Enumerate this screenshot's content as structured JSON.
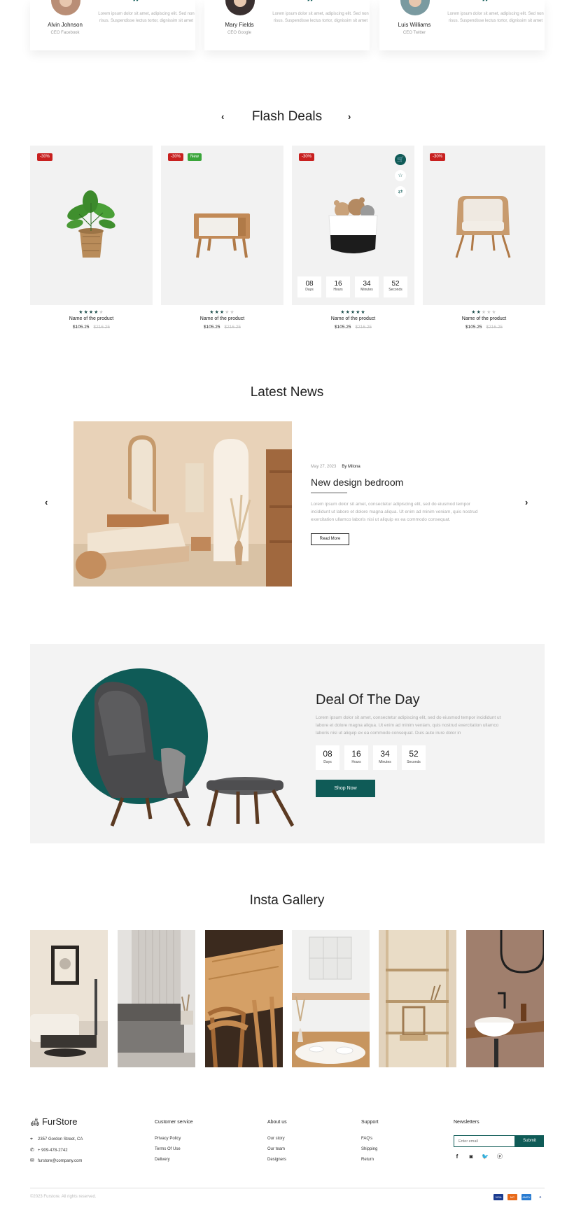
{
  "testimonials": [
    {
      "name": "Alvin Johnson",
      "role": "CEO Facebook",
      "text": "Lorem ipsum dolor sit amet, adipiscing elit. Sed non risus. Suspendisse lectus tortor, dignissim sit amet"
    },
    {
      "name": "Mary Fields",
      "role": "CEO Google",
      "text": "Lorem ipsum dolor sit amet, adipiscing elit. Sed non risus. Suspendisse lectus tortor, dignissim sit amet"
    },
    {
      "name": "Luis Williams",
      "role": "CEO Twitter",
      "text": "Lorem ipsum dolor sit amet, adipiscing elit. Sed non risus. Suspendisse lectus tortor, dignissim sit amet"
    }
  ],
  "flash": {
    "title": "Flash Deals",
    "prev_icon": "chevron-left-icon",
    "next_icon": "chevron-right-icon",
    "products": [
      {
        "badges": [
          "-30%"
        ],
        "name": "Name of the product",
        "price": "$105.25",
        "old_price": "$216.25",
        "rating": 4,
        "image": "potted-plant"
      },
      {
        "badges": [
          "-30%",
          "New"
        ],
        "name": "Name of the product",
        "price": "$105.25",
        "old_price": "$216.25",
        "rating": 3,
        "image": "nightstand"
      },
      {
        "badges": [
          "-30%"
        ],
        "name": "Name of the product",
        "price": "$105.25",
        "old_price": "$216.25",
        "rating": 5,
        "image": "toy-basket"
      },
      {
        "badges": [
          "-30%"
        ],
        "name": "Name of the product",
        "price": "$105.25",
        "old_price": "$216.25",
        "rating": 2,
        "image": "armchair"
      }
    ],
    "countdown": [
      {
        "value": "08",
        "label": "Days"
      },
      {
        "value": "16",
        "label": "Hours"
      },
      {
        "value": "34",
        "label": "Minutes"
      },
      {
        "value": "52",
        "label": "Seconds"
      }
    ]
  },
  "news": {
    "title": "Latest News",
    "date": "May 27, 2023",
    "author": "By Milona",
    "post_title": "New design bedroom",
    "text": "Lorem ipsum dolor sit amet, consectetur adipiscing elit, sed do eiusmod tempor incididunt ut labore et dolore magna aliqua. Ut enim ad minim veniam, quis nostrud exercitation ullamco laboris nisi ut aliquip ex ea commodo consequat.",
    "button": "Read More"
  },
  "deal": {
    "title": "Deal Of The Day",
    "text": "Lorem ipsum dolor sit amet, consectetur adipiscing elit, sed do eiusmod tempor incididunt ut labore et dolore magna aliqua. Ut enim ad minim veniam, quis nostrud exercitation ullamco laboris nisi ut aliquip ex ea commodo consequat. Duis aute irure dolor in",
    "countdown": [
      {
        "value": "08",
        "label": "Days"
      },
      {
        "value": "16",
        "label": "Hours"
      },
      {
        "value": "34",
        "label": "Minutes"
      },
      {
        "value": "52",
        "label": "Seconds"
      }
    ],
    "button": "Shop Now"
  },
  "gallery": {
    "title": "Insta Gallery"
  },
  "footer": {
    "logo": "FurStore",
    "address": "2357 Gordon Street, CA",
    "phone": "+ 909-478-2742",
    "email": "furstore@company.com",
    "columns": [
      {
        "title": "Customer service",
        "links": [
          "Privacy Policy",
          "Terms Of Use",
          "Delivery"
        ]
      },
      {
        "title": "About us",
        "links": [
          "Our story",
          "Our team",
          "Designers"
        ]
      },
      {
        "title": "Support",
        "links": [
          "FAQ's",
          "Shipping",
          "Return"
        ]
      }
    ],
    "newsletter": {
      "title": "Newsletters",
      "placeholder": "Enter email",
      "button": "Submit"
    },
    "social": [
      "facebook-icon",
      "instagram-icon",
      "twitter-icon",
      "pinterest-icon"
    ],
    "copyright": "©2023 Furstore. All rights reserved.",
    "payments": [
      "VISA",
      "MC",
      "AMEX",
      "P"
    ]
  },
  "colors": {
    "accent": "#0f5b57",
    "badge_red": "#c8201f",
    "badge_green": "#3aa53a",
    "panel": "#f2f2f2"
  }
}
